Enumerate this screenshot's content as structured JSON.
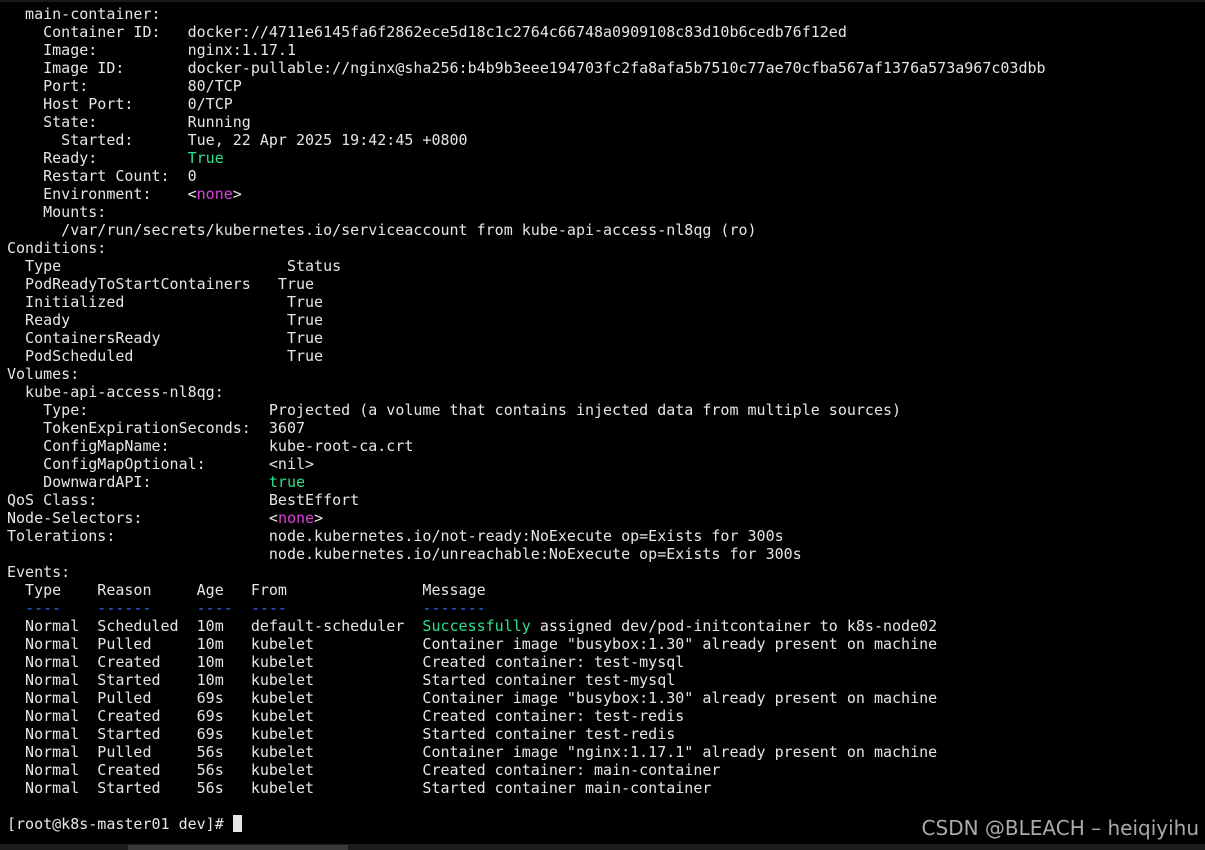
{
  "terminal": {
    "lines": [
      {
        "segments": [
          {
            "text": "  main-container:",
            "color": "default"
          }
        ]
      },
      {
        "segments": [
          {
            "text": "    Container ID:   docker://4711e6145fa6f2862ece5d18c1c2764c66748a0909108c83d10b6cedb76f12ed",
            "color": "default"
          }
        ]
      },
      {
        "segments": [
          {
            "text": "    Image:          nginx:1.17.1",
            "color": "default"
          }
        ]
      },
      {
        "segments": [
          {
            "text": "    Image ID:       docker-pullable://nginx@sha256:b4b9b3eee194703fc2fa8afa5b7510c77ae70cfba567af1376a573a967c03dbb",
            "color": "default"
          }
        ]
      },
      {
        "segments": [
          {
            "text": "    Port:           80/TCP",
            "color": "default"
          }
        ]
      },
      {
        "segments": [
          {
            "text": "    Host Port:      0/TCP",
            "color": "default"
          }
        ]
      },
      {
        "segments": [
          {
            "text": "    State:          Running",
            "color": "default"
          }
        ]
      },
      {
        "segments": [
          {
            "text": "      Started:      Tue, 22 Apr 2025 19:42:45 +0800",
            "color": "default"
          }
        ]
      },
      {
        "segments": [
          {
            "text": "    Ready:          ",
            "color": "default"
          },
          {
            "text": "True",
            "color": "green"
          }
        ]
      },
      {
        "segments": [
          {
            "text": "    Restart Count:  0",
            "color": "default"
          }
        ]
      },
      {
        "segments": [
          {
            "text": "    Environment:    <",
            "color": "default"
          },
          {
            "text": "none",
            "color": "magenta"
          },
          {
            "text": ">",
            "color": "default"
          }
        ]
      },
      {
        "segments": [
          {
            "text": "    Mounts:",
            "color": "default"
          }
        ]
      },
      {
        "segments": [
          {
            "text": "      /var/run/secrets/kubernetes.io/serviceaccount from kube-api-access-nl8qg (ro)",
            "color": "default"
          }
        ]
      },
      {
        "segments": [
          {
            "text": "Conditions:",
            "color": "default"
          }
        ]
      },
      {
        "segments": [
          {
            "text": "  Type                         Status",
            "color": "default"
          }
        ]
      },
      {
        "segments": [
          {
            "text": "  PodReadyToStartContainers   True",
            "color": "default"
          }
        ]
      },
      {
        "segments": [
          {
            "text": "  Initialized                  True",
            "color": "default"
          }
        ]
      },
      {
        "segments": [
          {
            "text": "  Ready                        True",
            "color": "default"
          }
        ]
      },
      {
        "segments": [
          {
            "text": "  ContainersReady              True",
            "color": "default"
          }
        ]
      },
      {
        "segments": [
          {
            "text": "  PodScheduled                 True",
            "color": "default"
          }
        ]
      },
      {
        "segments": [
          {
            "text": "Volumes:",
            "color": "default"
          }
        ]
      },
      {
        "segments": [
          {
            "text": "  kube-api-access-nl8qg:",
            "color": "default"
          }
        ]
      },
      {
        "segments": [
          {
            "text": "    Type:                    Projected (a volume that contains injected data from multiple sources)",
            "color": "default"
          }
        ]
      },
      {
        "segments": [
          {
            "text": "    TokenExpirationSeconds:  3607",
            "color": "default"
          }
        ]
      },
      {
        "segments": [
          {
            "text": "    ConfigMapName:           kube-root-ca.crt",
            "color": "default"
          }
        ]
      },
      {
        "segments": [
          {
            "text": "    ConfigMapOptional:       <nil>",
            "color": "default"
          }
        ]
      },
      {
        "segments": [
          {
            "text": "    DownwardAPI:             ",
            "color": "default"
          },
          {
            "text": "true",
            "color": "green"
          }
        ]
      },
      {
        "segments": [
          {
            "text": "QoS Class:                   BestEffort",
            "color": "default"
          }
        ]
      },
      {
        "segments": [
          {
            "text": "Node-Selectors:              <",
            "color": "default"
          },
          {
            "text": "none",
            "color": "magenta"
          },
          {
            "text": ">",
            "color": "default"
          }
        ]
      },
      {
        "segments": [
          {
            "text": "Tolerations:                 node.kubernetes.io/not-ready:NoExecute op=Exists for 300s",
            "color": "default"
          }
        ]
      },
      {
        "segments": [
          {
            "text": "                             node.kubernetes.io/unreachable:NoExecute op=Exists for 300s",
            "color": "default"
          }
        ]
      },
      {
        "segments": [
          {
            "text": "Events:",
            "color": "default"
          }
        ]
      },
      {
        "segments": [
          {
            "text": "  Type    Reason     Age   From               Message",
            "color": "default"
          }
        ]
      },
      {
        "segments": [
          {
            "text": "  ",
            "color": "default"
          },
          {
            "text": "----    ------     ----  ----               -------",
            "color": "blue"
          }
        ]
      },
      {
        "segments": [
          {
            "text": "  Normal  Scheduled  10m   default-scheduler  ",
            "color": "default"
          },
          {
            "text": "Successfully",
            "color": "green"
          },
          {
            "text": " assigned dev/pod-initcontainer to k8s-node02",
            "color": "default"
          }
        ]
      },
      {
        "segments": [
          {
            "text": "  Normal  Pulled     10m   kubelet            Container image \"busybox:1.30\" already present on machine",
            "color": "default"
          }
        ]
      },
      {
        "segments": [
          {
            "text": "  Normal  Created    10m   kubelet            Created container: test-mysql",
            "color": "default"
          }
        ]
      },
      {
        "segments": [
          {
            "text": "  Normal  Started    10m   kubelet            Started container test-mysql",
            "color": "default"
          }
        ]
      },
      {
        "segments": [
          {
            "text": "  Normal  Pulled     69s   kubelet            Container image \"busybox:1.30\" already present on machine",
            "color": "default"
          }
        ]
      },
      {
        "segments": [
          {
            "text": "  Normal  Created    69s   kubelet            Created container: test-redis",
            "color": "default"
          }
        ]
      },
      {
        "segments": [
          {
            "text": "  Normal  Started    69s   kubelet            Started container test-redis",
            "color": "default"
          }
        ]
      },
      {
        "segments": [
          {
            "text": "  Normal  Pulled     56s   kubelet            Container image \"nginx:1.17.1\" already present on machine",
            "color": "default"
          }
        ]
      },
      {
        "segments": [
          {
            "text": "  Normal  Created    56s   kubelet            Created container: main-container",
            "color": "default"
          }
        ]
      },
      {
        "segments": [
          {
            "text": "  Normal  Started    56s   kubelet            Started container main-container",
            "color": "default"
          }
        ]
      }
    ],
    "prompt": "[root@k8s-master01 dev]# ",
    "watermark": "CSDN @BLEACH – heiqiyihu"
  },
  "colors": {
    "background": "#000000",
    "default": "#e6e6e6",
    "green": "#2ee08a",
    "magenta": "#e040e0",
    "blue": "#2f6cf0"
  }
}
